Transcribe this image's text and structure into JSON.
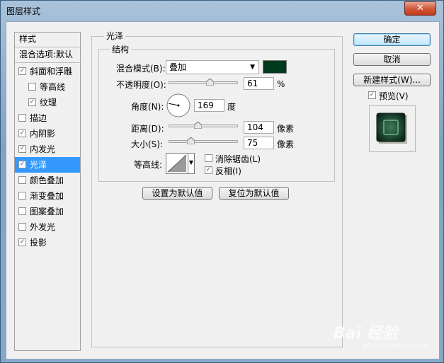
{
  "window": {
    "title": "图层样式",
    "close_label": "✕"
  },
  "sidebar": {
    "header_styles": "样式",
    "header_blend": "混合选项:默认",
    "items": [
      {
        "label": "斜面和浮雕",
        "checked": true,
        "indent": false
      },
      {
        "label": "等高线",
        "checked": false,
        "indent": true
      },
      {
        "label": "纹理",
        "checked": true,
        "indent": true
      },
      {
        "label": "描边",
        "checked": false,
        "indent": false
      },
      {
        "label": "内阴影",
        "checked": true,
        "indent": false
      },
      {
        "label": "内发光",
        "checked": true,
        "indent": false
      },
      {
        "label": "光泽",
        "checked": true,
        "indent": false,
        "selected": true
      },
      {
        "label": "颜色叠加",
        "checked": false,
        "indent": false
      },
      {
        "label": "渐变叠加",
        "checked": false,
        "indent": false
      },
      {
        "label": "图案叠加",
        "checked": false,
        "indent": false
      },
      {
        "label": "外发光",
        "checked": false,
        "indent": false
      },
      {
        "label": "投影",
        "checked": true,
        "indent": false
      }
    ]
  },
  "satin": {
    "group_title": "光泽",
    "structure_title": "结构",
    "blend_mode_label": "混合模式(B):",
    "blend_mode_value": "叠加",
    "color": "#003a1c",
    "opacity_label": "不透明度(O):",
    "opacity_value": "61",
    "opacity_unit": "%",
    "angle_label": "角度(N):",
    "angle_value": "169",
    "angle_unit": "度",
    "distance_label": "距离(D):",
    "distance_value": "104",
    "distance_unit": "像素",
    "size_label": "大小(S):",
    "size_value": "75",
    "size_unit": "像素",
    "contour_label": "等高线:",
    "antialias_label": "消除锯齿(L)",
    "antialias_checked": false,
    "invert_label": "反相(I)",
    "invert_checked": true,
    "make_default_label": "设置为默认值",
    "reset_default_label": "复位为默认值"
  },
  "actions": {
    "ok_label": "确定",
    "cancel_label": "取消",
    "new_style_label": "新建样式(W)...",
    "preview_label": "预览(V)",
    "preview_checked": true
  },
  "watermark": {
    "text": "Bai 经验",
    "sub": "jingyan.baidu.com"
  }
}
